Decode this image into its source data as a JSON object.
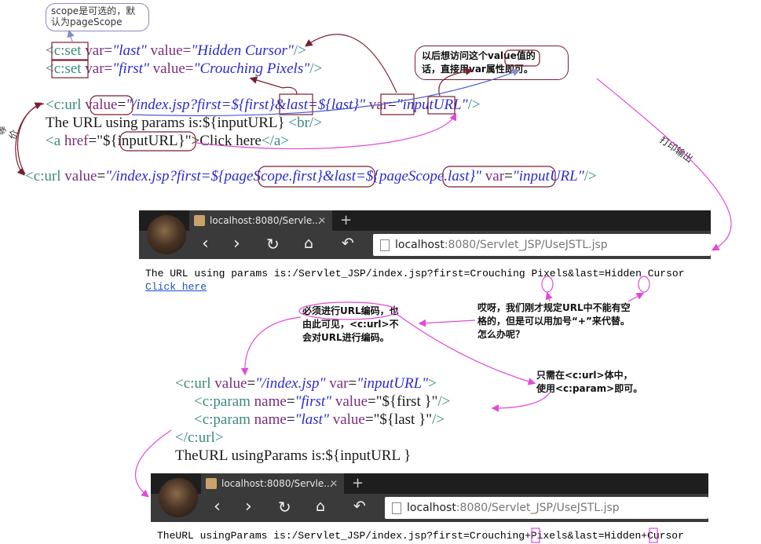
{
  "note_scope": {
    "line1": "scope是可选的，默",
    "line2": "认为pageScope"
  },
  "note_value": {
    "line1": "以后想访问这个value值的",
    "line2": "话，直接用var属性即可。"
  },
  "note_print": "打印输出",
  "note_equiv": "等价",
  "note_encode": {
    "line1": "必须进行URL编码，也",
    "line2": "由此可见，<c:url>不",
    "line3": "会对URL进行编码。"
  },
  "note_space": {
    "line1": "哎呀，我们刚才规定URL中不能有空",
    "line2": "格的，但是可以用加号“+”来代替。",
    "line3": "怎么办呢？"
  },
  "note_param": {
    "line1": "只需在<c:url>体中，",
    "line2": "使用<c:param>即可。"
  },
  "code1": {
    "set_last": {
      "open": "<c:set",
      "var_kw": " var=",
      "var_val": "\"last\"",
      "value_kw": " value=",
      "value_val": "\"Hidden Cursor\"",
      "close": "/>"
    },
    "set_first": {
      "open": "<c:set",
      "var_kw": " var=",
      "var_val": "\"first\"",
      "value_kw": " value=",
      "value_val": "\"Crouching Pixels\"",
      "close": "/>"
    },
    "url": {
      "open": "<c:url ",
      "value_kw": "value",
      "eq": "=",
      "value_val": "\"/index.jsp?first=${first}&last=${last}\"",
      "var_kw": " var",
      "eq2": "=",
      "var_val": "\"inputURL\"",
      "close": "/>"
    },
    "line_params": {
      "text": "The URL using params is:${inputURL} ",
      "br": "<br/>"
    },
    "line_href": {
      "open": "<a ",
      "href_kw": "href",
      "eq": "=",
      "href_val": "\"${inputURL}\"",
      "text": ">Click here",
      "close": "</a>"
    },
    "url_scope": {
      "open": "<c:url ",
      "value_kw": "value",
      "eq": "=",
      "value_val": "\"/index.jsp?first=${pageScope.first}&last=${pageScope.last}\"",
      "var_kw": " var",
      "eq2": "=",
      "var_val": "\"inputURL\"",
      "close": "/>"
    }
  },
  "browser1": {
    "tab": "localhost:8080/Servle...",
    "url_host": "localhost",
    "url_path": ":8080/Servlet_JSP/UseJSTL.jsp"
  },
  "output1": {
    "line": "The URL using params is:/Servlet_JSP/index.jsp?first=Crouching Pixels&last=Hidden Cursor",
    "link": "Click here"
  },
  "code2": {
    "url_open": {
      "open": "<c:url ",
      "value_kw": "value",
      "eq": "=",
      "value_val": "\"/index.jsp\"",
      "var_kw": " var",
      "eq2": "=",
      "var_val": "\"inputURL\"",
      "close": ">"
    },
    "param_first": {
      "open": "<c:param ",
      "name_kw": "name",
      "eq": "=",
      "name_val": "\"first\"",
      "value_kw": " value",
      "eq2": "=",
      "value_val": "\"${first }\"",
      "close": "/>"
    },
    "param_last": {
      "open": "<c:param ",
      "name_kw": "name",
      "eq": "=",
      "name_val": "\"last\"",
      "value_kw": " value",
      "eq2": "=",
      "value_val": "\"${last }\"",
      "close": "/>"
    },
    "url_close": "</c:url>",
    "line_params": "TheURL usingParams is:${inputURL }"
  },
  "browser2": {
    "tab": "localhost:8080/Servle...",
    "url_host": "localhost",
    "url_path": ":8080/Servlet_JSP/UseJSTL.jsp"
  },
  "output2": {
    "line": "TheURL usingParams is:/Servlet_JSP/index.jsp?first=Crouching+Pixels&last=Hidden+Cursor"
  },
  "colors": {
    "annotation": "#e04ad8",
    "box": "#7a1e2e",
    "arrow_dark": "#7a1e2e",
    "tag": "#3a8a7a",
    "attr": "#7a2d7a",
    "val": "#2a2ad0"
  }
}
